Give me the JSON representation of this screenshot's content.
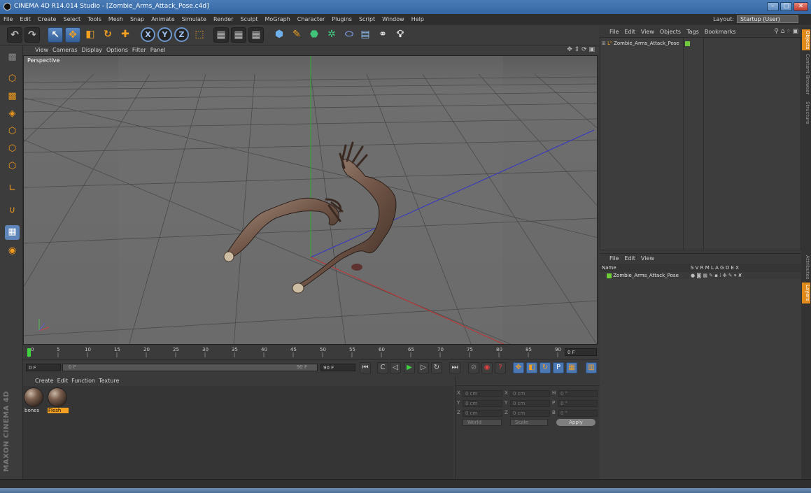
{
  "window": {
    "title": "CINEMA 4D R14.014 Studio - [Zombie_Arms_Attack_Pose.c4d]"
  },
  "menubar": {
    "items": [
      "File",
      "Edit",
      "Create",
      "Select",
      "Tools",
      "Mesh",
      "Snap",
      "Animate",
      "Simulate",
      "Render",
      "Sculpt",
      "MoGraph",
      "Character",
      "Plugins",
      "Script",
      "Window",
      "Help"
    ],
    "layout_label": "Layout:",
    "layout_value": "Startup (User)"
  },
  "toolbar": {
    "axis_x": "X",
    "axis_y": "Y",
    "axis_z": "Z"
  },
  "viewport": {
    "menu": [
      "View",
      "Cameras",
      "Display",
      "Options",
      "Filter",
      "Panel"
    ],
    "camera_label": "Perspective"
  },
  "timeline": {
    "ticks": [
      "0",
      "5",
      "10",
      "15",
      "20",
      "25",
      "30",
      "35",
      "40",
      "45",
      "50",
      "55",
      "60",
      "65",
      "70",
      "75",
      "80",
      "85",
      "90"
    ],
    "current_frame": "0 F",
    "start_frame": "0 F",
    "range_start": "0 F",
    "range_end": "90 F",
    "end_frame": "90 F"
  },
  "materials": {
    "menu": [
      "Create",
      "Edit",
      "Function",
      "Texture"
    ],
    "items": [
      {
        "name": "bones",
        "selected": false
      },
      {
        "name": "Flesh",
        "selected": true
      }
    ]
  },
  "coordinates": {
    "rows": [
      {
        "a1": "X",
        "v1": "0 cm",
        "a2": "X",
        "v2": "0 cm",
        "a3": "H",
        "v3": "0 °"
      },
      {
        "a1": "Y",
        "v1": "0 cm",
        "a2": "Y",
        "v2": "0 cm",
        "a3": "P",
        "v3": "0 °"
      },
      {
        "a1": "Z",
        "v1": "0 cm",
        "a2": "Z",
        "v2": "0 cm",
        "a3": "B",
        "v3": "0 °"
      }
    ],
    "space": "World",
    "mode": "Scale",
    "apply": "Apply"
  },
  "object_manager": {
    "menu": [
      "File",
      "Edit",
      "View",
      "Objects",
      "Tags",
      "Bookmarks"
    ],
    "objects": [
      {
        "name": "Zombie_Arms_Attack_Pose"
      }
    ]
  },
  "layer_manager": {
    "menu": [
      "File",
      "Edit",
      "View"
    ],
    "header_name": "Name",
    "header_flags": "S V R M L A G D E X",
    "layers": [
      {
        "name": "Zombie_Arms_Attack_Pose"
      }
    ]
  },
  "side_tabs": [
    "Objects",
    "Content Browser",
    "Structure",
    "Attributes",
    "Layers"
  ],
  "brand": "MAXON CINEMA 4D"
}
